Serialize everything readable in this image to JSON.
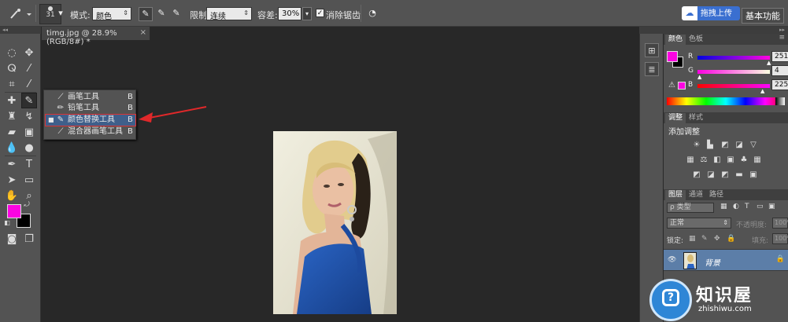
{
  "options_bar": {
    "brush_size": "31",
    "mode_label": "模式:",
    "mode_value": "颜色",
    "limits_label": "限制:",
    "limits_value": "连续",
    "tolerance_label": "容差:",
    "tolerance_value": "30%",
    "antialias_label": "消除锯齿",
    "upload_label": "拖拽上传",
    "workspace_label": "基本功能"
  },
  "document_tab": {
    "title": "timg.jpg @ 28.9%(RGB/8#) *",
    "close": "×"
  },
  "flyout_menu": {
    "items": [
      {
        "label": "画笔工具",
        "key": "B",
        "icon": "brush-icon"
      },
      {
        "label": "铅笔工具",
        "key": "B",
        "icon": "pencil-icon"
      },
      {
        "label": "颜色替换工具",
        "key": "B",
        "icon": "color-replacement-icon"
      },
      {
        "label": "混合器画笔工具",
        "key": "B",
        "icon": "mixer-brush-icon"
      }
    ],
    "selected_index": 2
  },
  "colors": {
    "foreground": "#fb04e1",
    "background": "#000000",
    "accent_red": "#e0282a"
  },
  "color_panel": {
    "tabs": [
      "颜色",
      "色板"
    ],
    "r_label": "R",
    "r_value": "251",
    "g_label": "G",
    "g_value": "4",
    "b_label": "B",
    "b_value": "225"
  },
  "adjustments_panel": {
    "tabs": [
      "调整",
      "样式"
    ],
    "title": "添加调整"
  },
  "layers_panel": {
    "tabs": [
      "图层",
      "通道",
      "路径"
    ],
    "filter_label": "ρ 类型",
    "blend_mode": "正常",
    "opacity_label": "不透明度:",
    "opacity_value": "100%",
    "lock_label": "锁定:",
    "fill_label": "填充:",
    "fill_value": "100%",
    "layer_name": "背景"
  },
  "watermark": {
    "name": "知识屋",
    "url": "zhishiwu.com"
  }
}
